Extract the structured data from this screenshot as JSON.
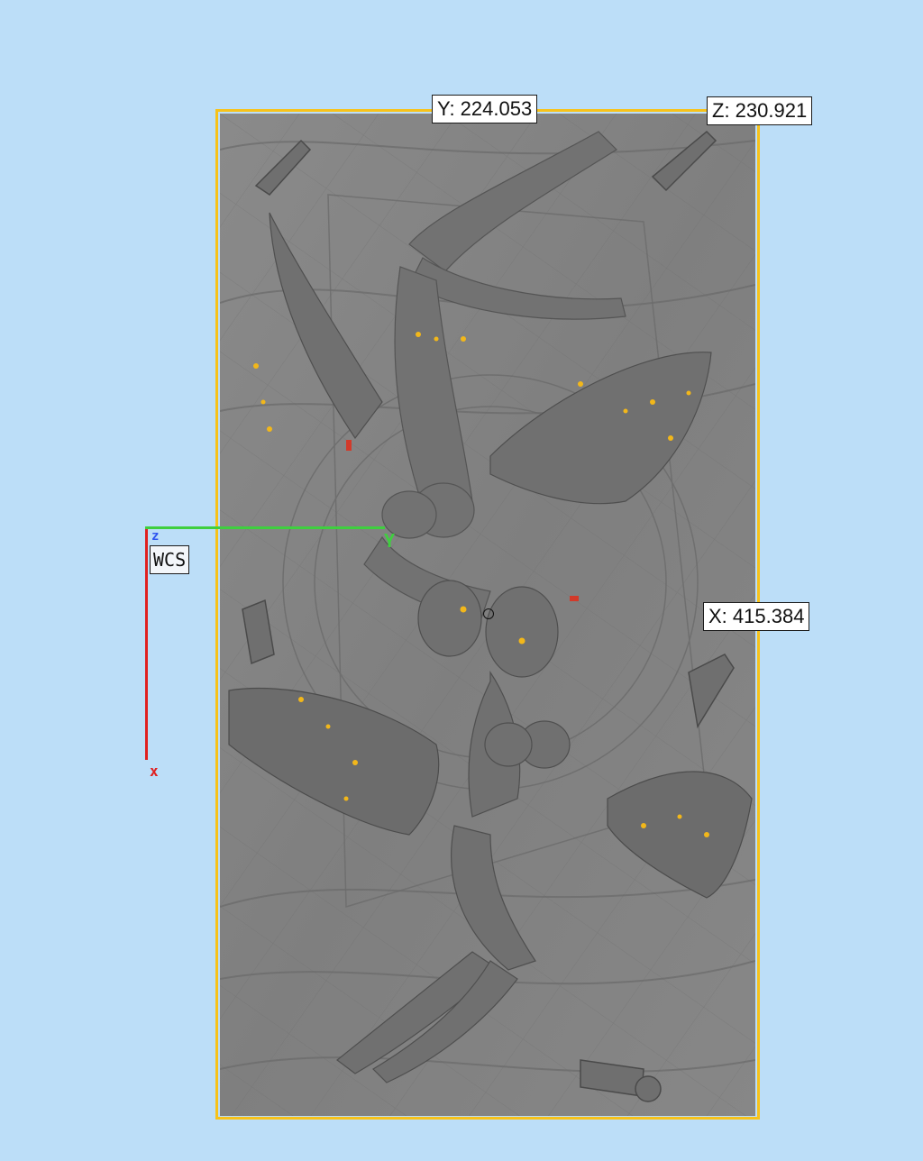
{
  "viewport": {
    "background": "#BCDEF8",
    "bounding_box_color": "#F7C21A",
    "model_color": "#858585"
  },
  "dimensions": {
    "y_label": "Y: 224.053",
    "z_label": "Z: 230.921",
    "x_label": "X: 415.384"
  },
  "axes": {
    "x_label": "x",
    "y_label": "Y",
    "z_label": "z",
    "wcs_label": "WCS",
    "x_color": "#E02020",
    "y_color": "#3FCF3F",
    "z_color": "#2E55F0"
  },
  "icons": {
    "pivot": "circle-icon"
  }
}
